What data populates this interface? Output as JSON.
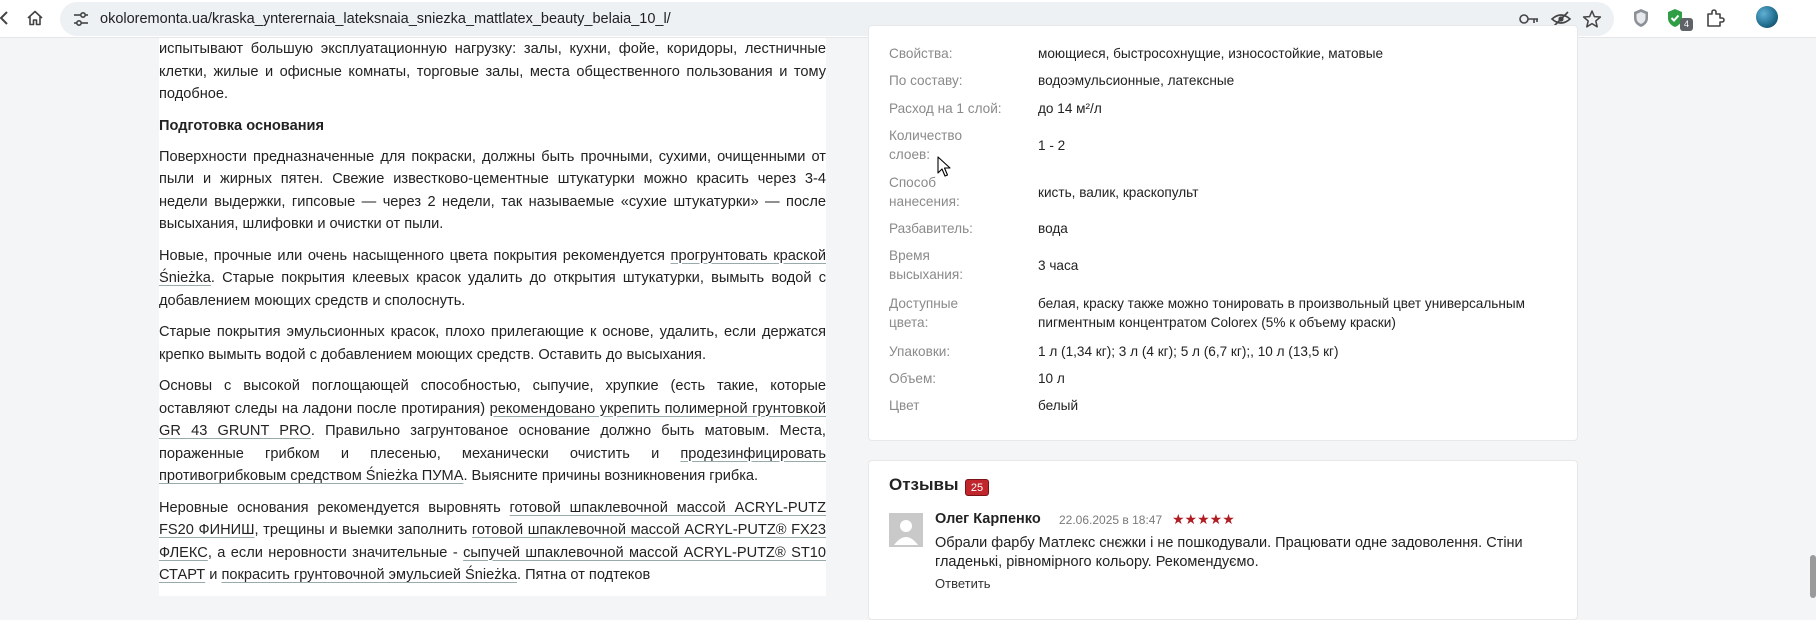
{
  "browser": {
    "url": "okoloremonta.ua/kraska_ynterernaia_lateksnaia_sniezka_mattlatex_beauty_belaia_10_l/",
    "extension_badge": "4",
    "icons": [
      "back-arrow-icon",
      "home-icon",
      "site-settings-icon",
      "key-icon",
      "eye-off-icon",
      "star-icon",
      "shield-extension-icon",
      "extension-icon",
      "puzzle-icon",
      "profile-avatar"
    ]
  },
  "article": {
    "p1": "испытывают большую эксплуатационную нагрузку: залы, кухни, фойе, коридоры, лестничные клетки, жилые и офисные комнаты, торговые залы, места общественного пользования и тому подобное.",
    "heading": "Подготовка основания",
    "p2": "Поверхности предназначенные для покраски, должны быть прочными, сухими, очищенными от пыли и жирных пятен. Свежие известково-цементные штукатурки можно красить через 3-4 недели выдержки, гипсовые — через 2 недели, так называемые «сухие штукатурки» — после высыхания, шлифовки и очистки от пыли.",
    "p3_a": "Новые, прочные или очень насыщенного цвета покрытия рекомендуется ",
    "p3_link": "прогрунтовать краской Śnieżka",
    "p3_b": ". Старые покрытия клеевых красок удалить до открытия штукатурки, вымыть водой с добавлением моющих средств и сполоснуть.",
    "p4": "Старые покрытия эмульсионных красок, плохо прилегающие к основе, удалить, если держатся крепко вымыть водой с добавлением моющих средств. Оставить до высыхания.",
    "p5_a": "Основы с высокой поглощающей способностью, сыпучие, хрупкие (есть такие, которые оставляют следы на ладони после протирания) ",
    "p5_link1": "рекомендовано укрепить полимерной грунтовкой GR 43 GRUNT PRO",
    "p5_b": ". Правильно загрунтованое основание должно быть матовым. Места, пораженные грибком и плесенью, механически очистить и ",
    "p5_link2": "продезинфицировать противогрибковым средством Śnieżka ПУМА",
    "p5_c": ". Выясните причины возникновения грибка.",
    "p6_a": "Неровные основания рекомендуется выровнять ",
    "p6_link1": "готовой шпаклевочной массой ACRYL-PUTZ FS20 ФИНИШ",
    "p6_b": ", трещины и выемки заполнить ",
    "p6_link2": "готовой шпаклевочной массой ACRYL-PUTZ® FX23 ФЛЕКС",
    "p6_c": ", а если неровности значительные - ",
    "p6_link3": "сыпучей шпаклевочной массой ACRYL-PUTZ® ST10 СТАРТ",
    "p6_d": " и ",
    "p6_link4": "покрасить грунтовочной эмульсией Śnieżka",
    "p6_e": ". Пятна от подтеков"
  },
  "properties": [
    {
      "key": "Свойства:",
      "value": "моющиеся, быстросохнущие, износостойкие, матовые"
    },
    {
      "key": "По составу:",
      "value": "водоэмульсионные, латексные"
    },
    {
      "key": "Расход на 1 слой:",
      "value": "до 14 м²/л"
    },
    {
      "key": "Количество слоев:",
      "value": "1 - 2"
    },
    {
      "key": "Способ нанесения:",
      "value": "кисть, валик, краскопульт"
    },
    {
      "key": "Разбавитель:",
      "value": "вода"
    },
    {
      "key": "Время высыхания:",
      "value": "3 часа"
    },
    {
      "key": "Доступные цвета:",
      "value": "белая, краску также можно тонировать в произвольный цвет универсальным пигментным концентратом Colorex (5% к объему краски)"
    },
    {
      "key": "Упаковки:",
      "value": "1 л (1,34 кг); 3 л (4 кг); 5 л (6,7 кг);, 10 л (13,5 кг)"
    },
    {
      "key": "Объем:",
      "value": "10 л"
    },
    {
      "key": "Цвет",
      "value": "белый"
    }
  ],
  "reviews": {
    "title": "Отзывы",
    "count": "25",
    "items": [
      {
        "author": "Олег Карпенко",
        "date": "22.06.2025 в 18:47",
        "stars": "★★★★★",
        "rating": 5,
        "text": "Обрали фарбу Матлекс снєжки і не пошкодували. Працювати одне задоволення. Стіни гладенькі, рівномірного кольору. Рекомендуємо.",
        "reply": "Ответить"
      }
    ]
  },
  "colors": {
    "accent": "#c0262c",
    "muted": "#8a8a8a",
    "page_bg": "#f4f5f7"
  }
}
